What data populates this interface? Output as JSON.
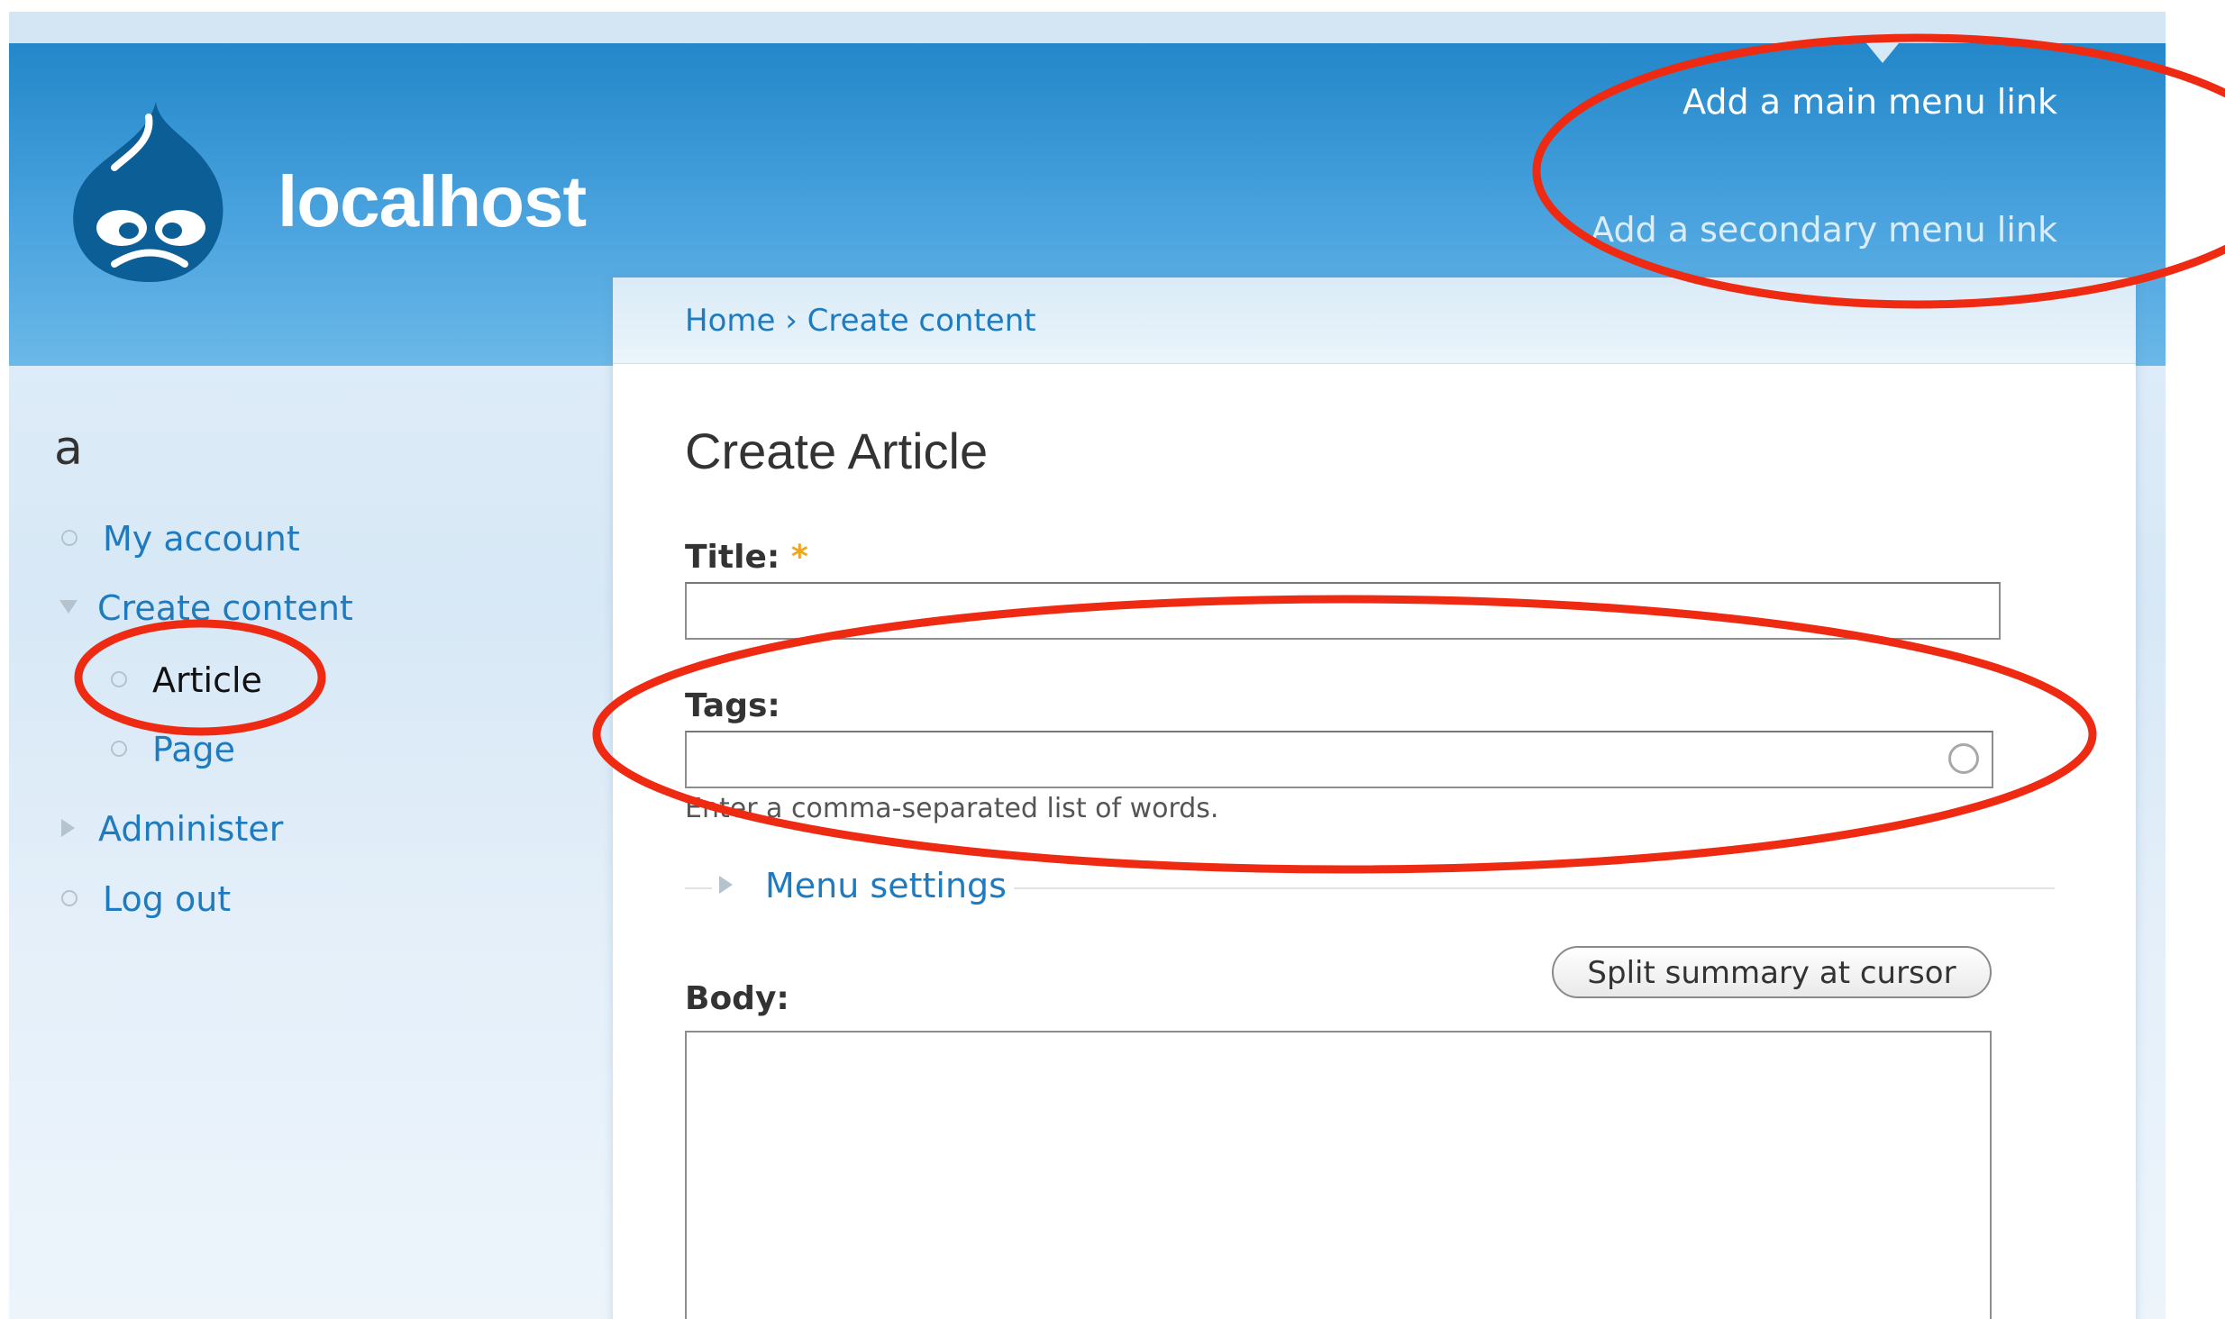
{
  "header": {
    "site_name": "localhost",
    "main_menu_link": "Add a main menu link",
    "secondary_menu_link": "Add a secondary menu link"
  },
  "sidebar": {
    "title": "a",
    "items": [
      {
        "label": "My account",
        "icon": "bullet-icon"
      },
      {
        "label": "Create content",
        "icon": "expanded-triangle-icon"
      },
      {
        "label": "Article",
        "icon": "bullet-icon",
        "active": true
      },
      {
        "label": "Page",
        "icon": "bullet-icon"
      },
      {
        "label": "Administer",
        "icon": "collapsed-triangle-icon"
      },
      {
        "label": "Log out",
        "icon": "bullet-icon"
      }
    ]
  },
  "breadcrumb": {
    "home": "Home",
    "separator": "›",
    "current": "Create content"
  },
  "form": {
    "page_title": "Create Article",
    "title_label": "Title:",
    "required_mark": "*",
    "title_value": "",
    "tags_label": "Tags:",
    "tags_value": "",
    "tags_description": "Enter a comma-separated list of words.",
    "menu_settings": "Menu settings",
    "split_button": "Split summary at cursor",
    "body_label": "Body:",
    "body_value": ""
  },
  "colors": {
    "header_blue": "#2387c9",
    "link_blue": "#1f7bbf",
    "annotation_red": "#ee2a12",
    "required_orange": "#f0a51f"
  }
}
